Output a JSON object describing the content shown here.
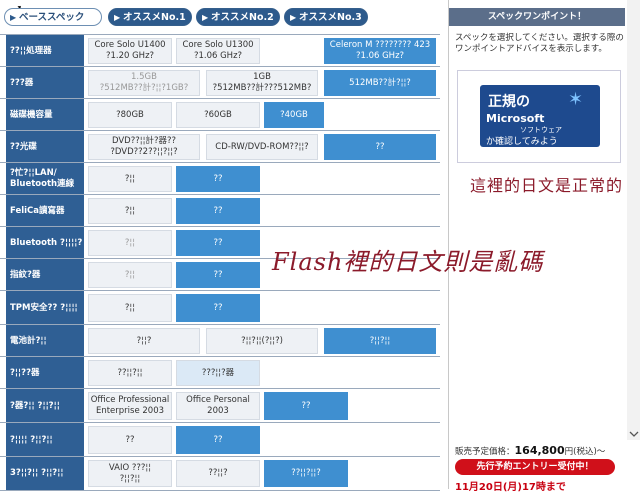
{
  "tabs": [
    {
      "label": "ベーススペック"
    },
    {
      "label": "オススメNo.1"
    },
    {
      "label": "オススメNo.2"
    },
    {
      "label": "オススメNo.3"
    }
  ],
  "rows": [
    {
      "label": "??¦¦処理器",
      "cells": [
        "Core Solo U1400\n?1.20 GHz?",
        "Core Solo U1300\n?1.06 GHz?",
        "Celeron M ???????? 423\n?1.06 GHz?"
      ]
    },
    {
      "label": "???器",
      "cells": [
        "1.5GB\n?512MB??計?¦¦?1GB?",
        "1GB\n?512MB??計???512MB?",
        "512MB??計?¦¦?"
      ]
    },
    {
      "label": "磁碟機容量",
      "cells": [
        "?80GB",
        "?60GB",
        "?40GB"
      ]
    },
    {
      "label": "??光碟",
      "cells": [
        "DVD??¦¦計?器??\n?DVD??2??¦¦?¦¦?",
        "CD-RW/DVD-ROM??¦¦?",
        "??"
      ]
    },
    {
      "label": "?忙?¦¦LAN/\nBluetooth連線",
      "cells": [
        "?¦¦",
        "??"
      ]
    },
    {
      "label": "FeliCa讀寫器",
      "cells": [
        "?¦¦",
        "??"
      ]
    },
    {
      "label": "Bluetooth\n?¦¦¦¦?",
      "cells": [
        "?¦¦",
        "??"
      ]
    },
    {
      "label": "指紋?器",
      "cells": [
        "?¦¦",
        "??"
      ]
    },
    {
      "label": "TPM安全??\n?¦¦¦¦",
      "cells": [
        "?¦¦",
        "??"
      ]
    },
    {
      "label": "電池計?¦¦",
      "cells": [
        "?¦¦?",
        "?¦¦?¦¦(?¦¦?)",
        "?¦¦?¦¦"
      ]
    },
    {
      "label": "?¦¦??器",
      "cells": [
        "??¦¦?¦¦",
        "???¦¦?器"
      ]
    },
    {
      "label": "?器?¦¦\n?¦¦?¦¦",
      "cells": [
        "Office Professional\nEnterprise 2003",
        "Office Personal\n2003",
        "??"
      ]
    },
    {
      "label": "?¦¦¦¦\n?¦¦?¦¦",
      "cells": [
        "??",
        "??"
      ]
    },
    {
      "label": "3?¦¦?¦¦\n?¦¦?¦¦",
      "cells": [
        "VAIO ???¦¦\n?¦¦?¦¦",
        "??¦¦?",
        "??¦¦?¦¦?"
      ]
    }
  ],
  "right": {
    "header": "スペックワンポイント！",
    "text": "スペックを選択してください。選択する際のワンポイントアドバイスを表示します。",
    "ad": {
      "l1": "正規の",
      "l2": "Microsoft",
      "l3": "ソフトウェア",
      "l4": "か確認してみよう"
    },
    "price_label": "販売予定価格：",
    "price_value": "164,800",
    "price_suffix": "円(税込)～",
    "reserve_button": "先行予約エントリー受付中！",
    "date_text": "11月20日(月)17時まで"
  },
  "annotations": {
    "note1": "這裡的日文是正常的",
    "note2": "Flash裡的日文則是亂碼"
  }
}
